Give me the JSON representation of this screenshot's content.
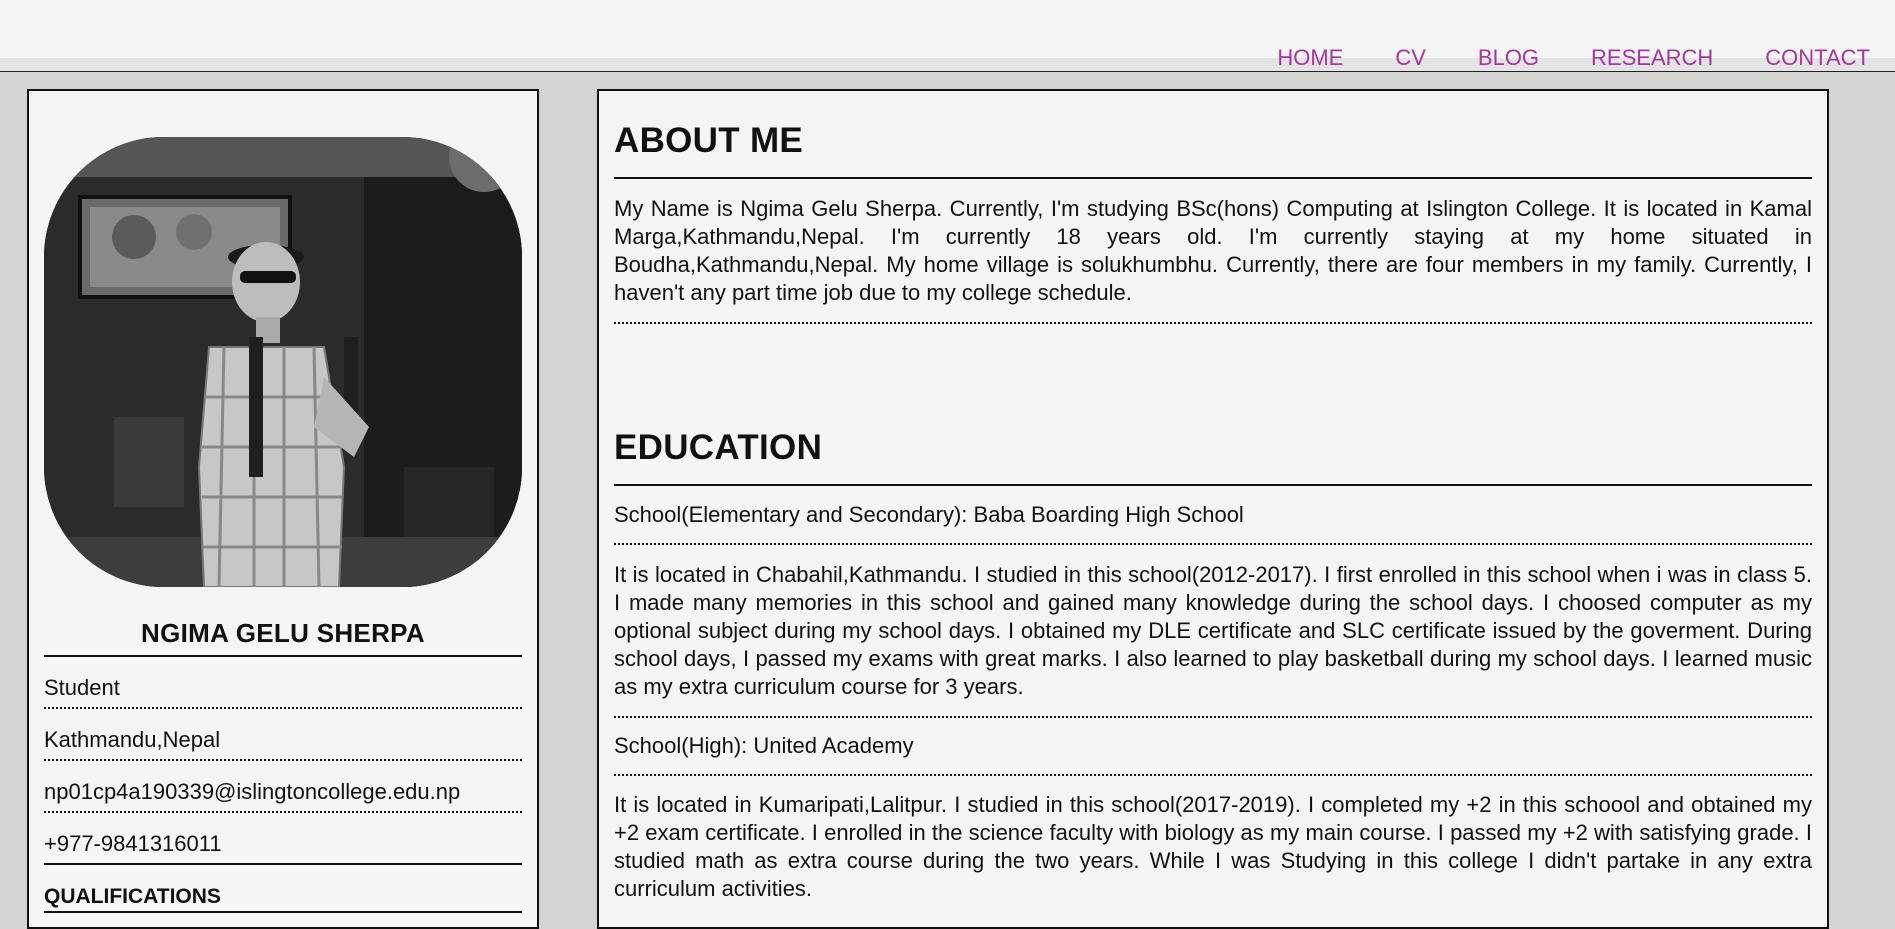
{
  "nav": {
    "items": [
      "HOME",
      "CV",
      "BLOG",
      "RESEARCH",
      "CONTACT"
    ]
  },
  "profile": {
    "name": "NGIMA GELU SHERPA",
    "role": "Student",
    "location": "Kathmandu,Nepal",
    "email": "np01cp4a190339@islingtoncollege.edu.np",
    "phone": "+977-9841316011",
    "qualifications_heading": "QUALIFICATIONS"
  },
  "about": {
    "heading": "ABOUT ME",
    "text": "My Name is Ngima Gelu Sherpa. Currently, I'm studying BSc(hons) Computing at Islington College. It is located in Kamal Marga,Kathmandu,Nepal. I'm currently 18 years old. I'm currently staying at my home situated in Boudha,Kathmandu,Nepal. My home village is solukhumbhu. Currently, there are four members in my family. Currently, I haven't any part time job due to my college schedule."
  },
  "education": {
    "heading": "EDUCATION",
    "schools": [
      {
        "title": "School(Elementary and Secondary): Baba Boarding High School",
        "text": "It is located in Chabahil,Kathmandu. I studied in this school(2012-2017). I first enrolled in this school when i was in class 5. I made many memories in this school and gained many knowledge during the school days. I choosed computer as my optional subject during my school days. I obtained my DLE certificate and SLC certificate issued by the goverment. During school days, I passed my exams with great marks. I also learned to play basketball during my school days. I learned music as my extra curriculum course for 3 years."
      },
      {
        "title": "School(High): United Academy",
        "text": "It is located in Kumaripati,Lalitpur. I studied in this school(2017-2019). I completed my +2 in this schoool and obtained my +2 exam certificate. I enrolled in the science faculty with biology as my main course. I passed my +2 with satisfying grade. I studied math as extra course during the two years. While I was Studying in this college I didn't partake in any extra curriculum activities."
      }
    ]
  }
}
